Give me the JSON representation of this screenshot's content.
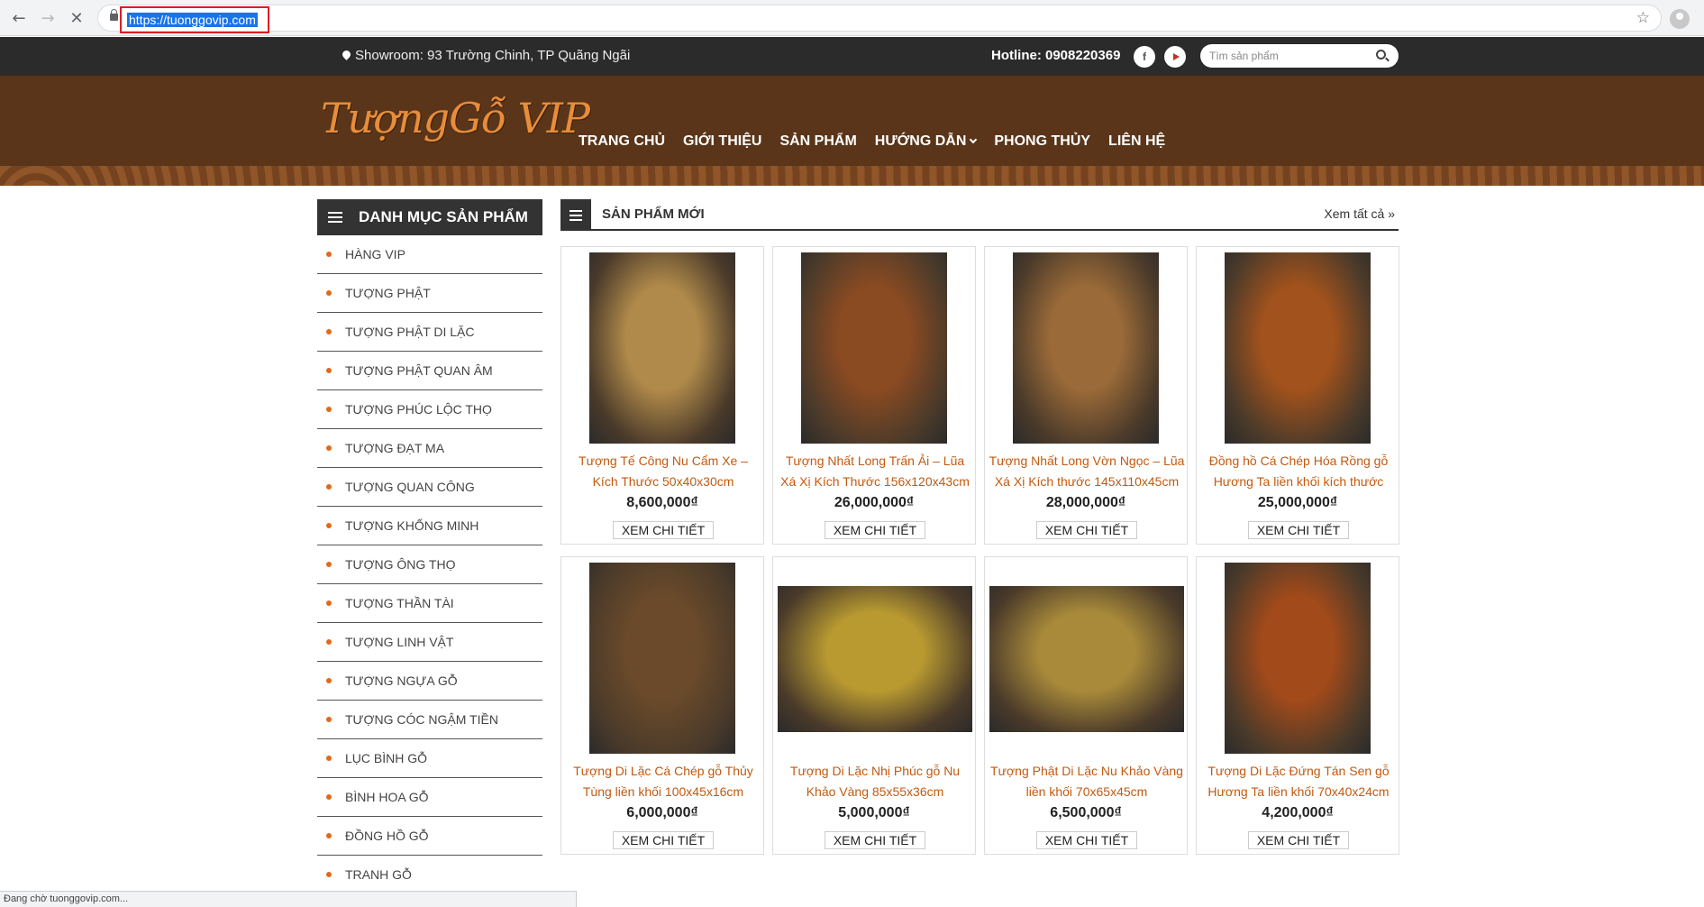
{
  "browser": {
    "url": "https://tuonggovip.com",
    "status": "Đang chờ tuonggovip.com..."
  },
  "topbar": {
    "showroom": "Showroom: 93 Trường Chinh, TP Quãng Ngãi",
    "hotline": "Hotline: 0908220369",
    "facebook": "f",
    "search_placeholder": "Tìm sản phẩm"
  },
  "header": {
    "logo": "TượngGỗ VIP",
    "menu": [
      "TRANG CHỦ",
      "GIỚI THIỆU",
      "SẢN PHẨM",
      "HƯỚNG DẪN",
      "PHONG THỦY",
      "LIÊN HỆ"
    ]
  },
  "sidebar": {
    "title": "DANH MỤC SẢN PHẨM",
    "items": [
      "HÀNG VIP",
      "TƯỢNG PHẬT",
      "TƯỢNG PHẬT DI LẶC",
      "TƯỢNG PHẬT QUAN ÂM",
      "TƯỢNG PHÚC LỘC THỌ",
      "TƯỢNG ĐẠT MA",
      "TƯỢNG QUAN CÔNG",
      "TƯỢNG KHỔNG MINH",
      "TƯỢNG ÔNG THỌ",
      "TƯỢNG THẦN TÀI",
      "TƯỢNG LINH VẬT",
      "TƯỢNG NGỰA GỖ",
      "TƯỢNG CÓC NGẬM TIỀN",
      "LỤC BÌNH GỖ",
      "BÌNH HOA GỖ",
      "ĐỒNG HỒ GỖ",
      "TRANH GỖ"
    ]
  },
  "main": {
    "title": "SẢN PHẨM MỚI",
    "view_all": "Xem tất cả »",
    "button_label": "XEM CHI TIẾT",
    "products": [
      {
        "title": "Tượng Tế Công Nu Cẩm Xe – Kích Thước 50x40x30cm",
        "price": "8,600,000₫",
        "color": "#b08a4a"
      },
      {
        "title": "Tượng Nhất Long Trấn Ải – Lũa Xá Xị Kích Thước 156x120x43cm",
        "price": "26,000,000₫",
        "color": "#8a4a22"
      },
      {
        "title": "Tượng Nhất Long Vờn Ngọc – Lũa Xá Xị Kích thước 145x110x45cm",
        "price": "28,000,000₫",
        "color": "#9a6a38"
      },
      {
        "title": "Đồng hồ Cá Chép Hóa Rồng gỗ Hương Ta liền khối kích thước",
        "price": "25,000,000₫",
        "color": "#a2521c"
      },
      {
        "title": "Tượng Di Lặc Cá Chép gỗ Thủy Tùng liền khối 100x45x16cm",
        "price": "6,000,000₫",
        "color": "#6a4a2a"
      },
      {
        "title": "Tượng Di Lặc Nhị Phúc gỗ Nu Khảo Vàng 85x55x36cm",
        "price": "5,000,000₫",
        "color": "#b89a30"
      },
      {
        "title": "Tượng Phật Di Lặc Nu Khảo Vàng liền khối 70x65x45cm",
        "price": "6,500,000₫",
        "color": "#a88a3a"
      },
      {
        "title": "Tượng Di Lặc Đứng Tán Sen gỗ Hương Ta liền khối 70x40x24cm",
        "price": "4,200,000₫",
        "color": "#a24a1a"
      }
    ]
  }
}
